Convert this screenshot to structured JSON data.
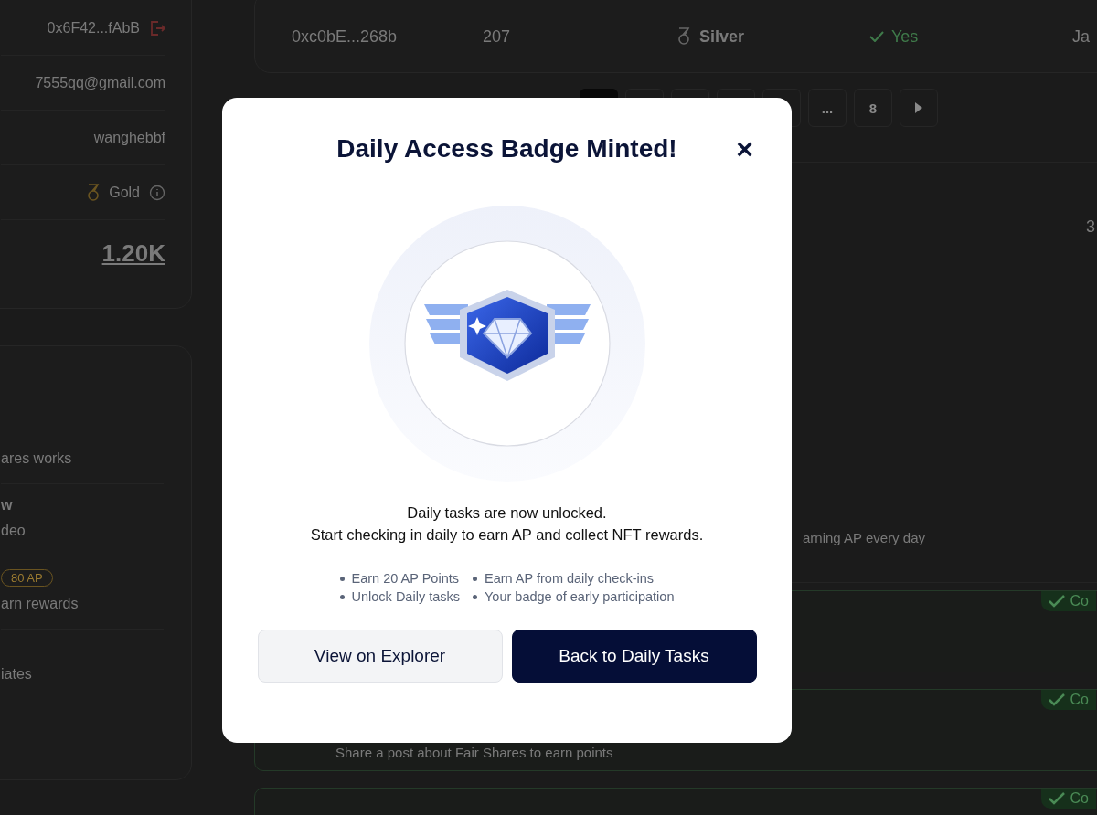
{
  "account_card": {
    "rows": [
      {
        "kind": "address",
        "value": "0x6F42...fAbB"
      },
      {
        "kind": "text",
        "value": "7555qq@gmail.com"
      },
      {
        "kind": "text",
        "value": "wanghebbf"
      },
      {
        "kind": "tier",
        "value": "Gold"
      },
      {
        "kind": "points",
        "value": "1.20K"
      }
    ]
  },
  "info_card": {
    "items": [
      {
        "text": "ares works"
      },
      {
        "title": "w",
        "text": "deo"
      },
      {
        "badge": "80 AP",
        "text": "arn rewards"
      },
      {
        "text": "iates"
      }
    ]
  },
  "table": {
    "rows": [
      {
        "address": "0xc0bE...268b",
        "count": "207",
        "tier": "Silver",
        "verified": "Yes",
        "date": "Ja"
      }
    ]
  },
  "pagination": {
    "pages": [
      {
        "selected": true
      },
      {
        "selected": false
      },
      {
        "selected": false
      },
      {
        "selected": false
      },
      {
        "selected": false
      },
      {
        "label": "...",
        "selected": false
      },
      {
        "label": "8",
        "selected": false
      }
    ]
  },
  "stats": {
    "value": "3",
    "hint": "arning AP every day"
  },
  "tasks": [
    {
      "status": "Co"
    },
    {
      "status": "Co",
      "description": "Share a post about Fair Shares to earn points"
    },
    {
      "status": "Co"
    }
  ],
  "modal": {
    "title": "Daily Access Badge Minted!",
    "close": "×",
    "lines": [
      "Daily tasks are now unlocked.",
      "Start checking in daily to earn AP and collect NFT rewards."
    ],
    "bullets": [
      [
        "Earn 20 AP Points",
        "Unlock Daily tasks"
      ],
      [
        "Earn AP from daily check-ins",
        "Your badge of early participation"
      ]
    ],
    "buttons": [
      {
        "kind": "secondary",
        "label": "View on Explorer"
      },
      {
        "kind": "primary",
        "label": "Back to Daily Tasks"
      }
    ]
  }
}
